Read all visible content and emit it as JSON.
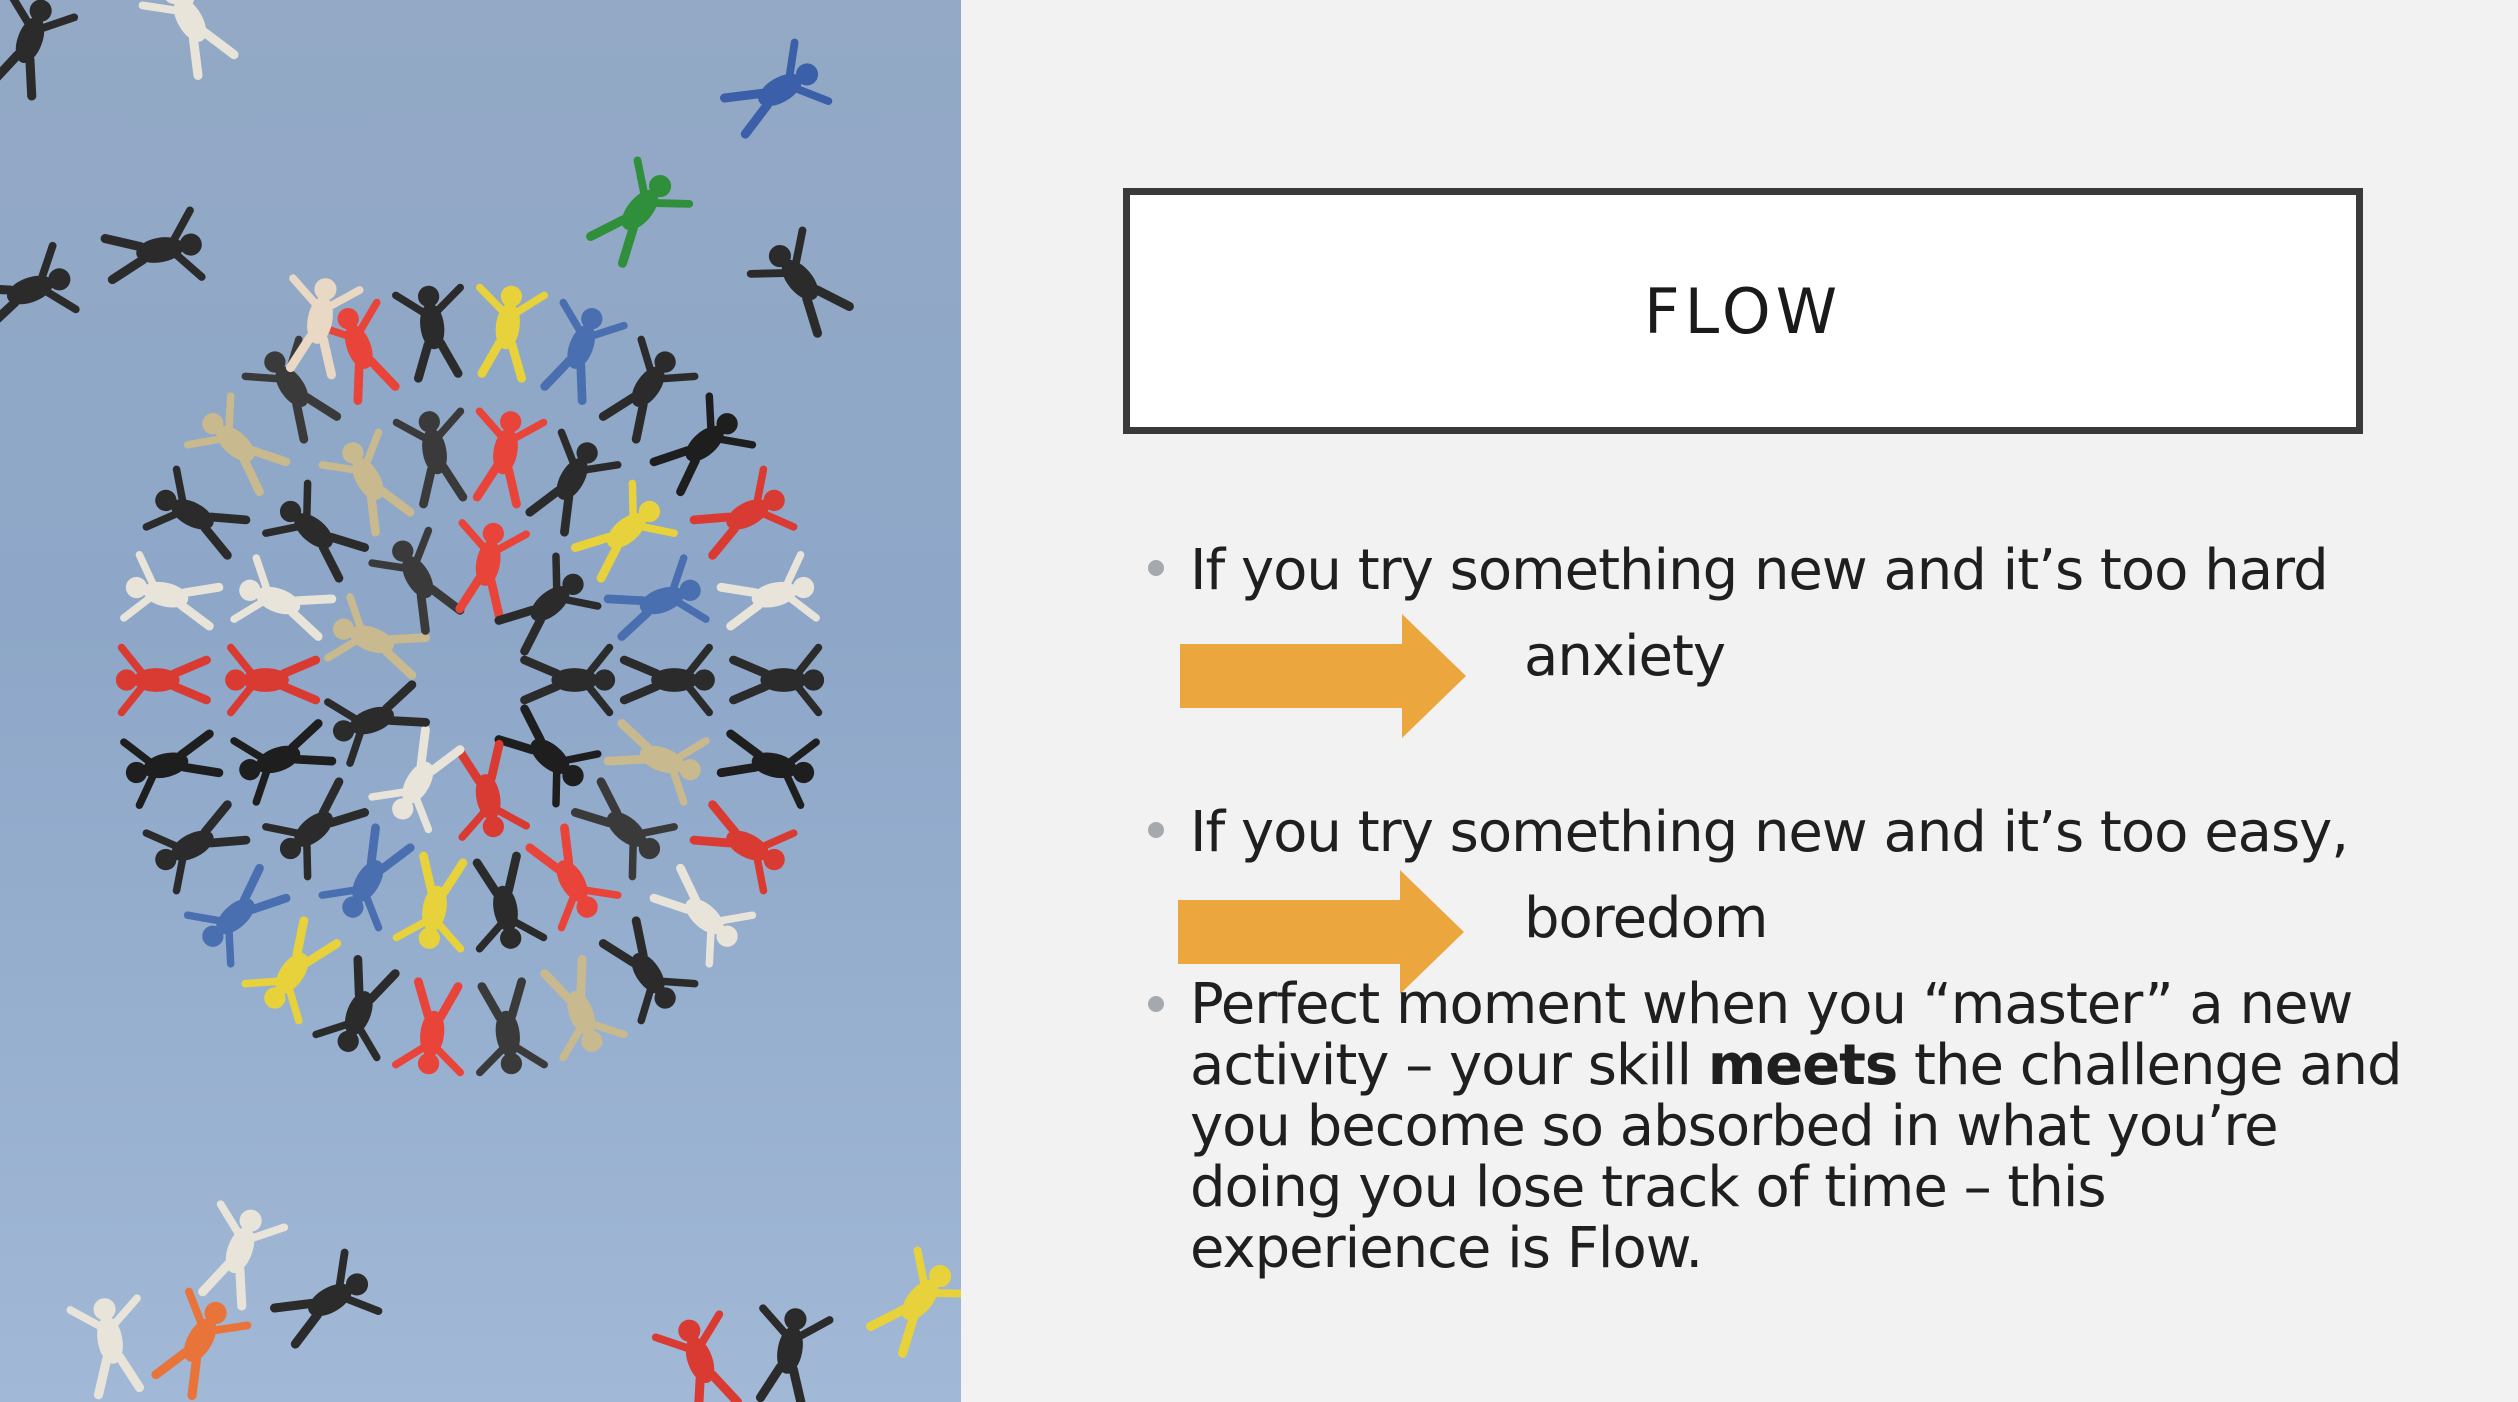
{
  "slide": {
    "title": "FLOW",
    "bullets": [
      {
        "text": "If you try something new and it’s too hard",
        "result": "anxiety"
      },
      {
        "text": "If you try something new and it’s too easy,",
        "result": "boredom"
      },
      {
        "text_before": "Perfect moment when you “master” a new activity – your skill ",
        "text_bold": "meets",
        "text_after": " the challenge and you become so absorbed in what you’re doing you lose track of time – this experience is Flow."
      }
    ],
    "photo": {
      "description_icon": "skydivers-formation-image"
    },
    "colors": {
      "background": "#f2f2f2",
      "arrow": "#eba73d",
      "title_border": "#3a3a3a",
      "bullet_dot": "#a4a9ae",
      "sky": "#8ea7c8"
    }
  }
}
